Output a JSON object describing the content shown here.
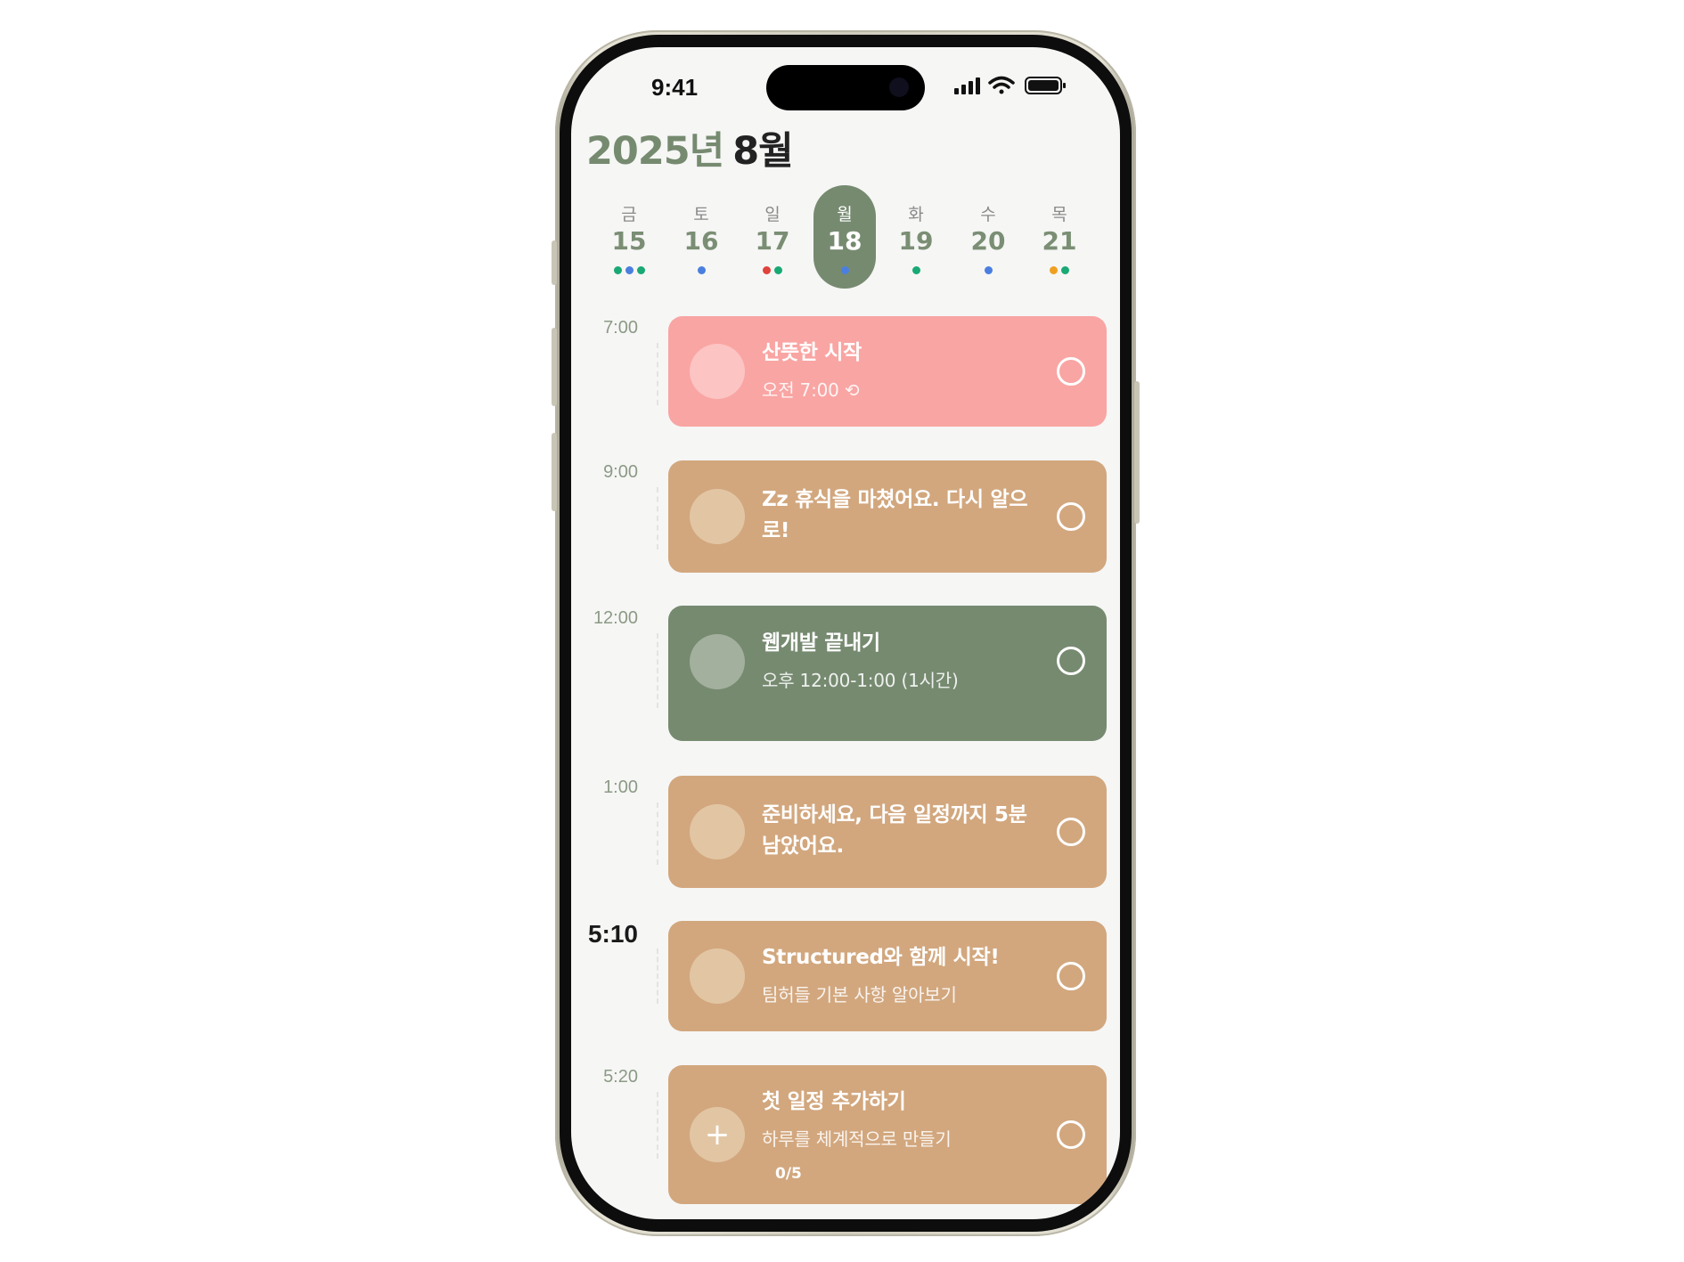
{
  "status_bar": {
    "time": "9:41"
  },
  "header": {
    "year": "2025년",
    "month": "8월"
  },
  "week": [
    {
      "weekday": "금",
      "date": "15",
      "dots": [
        "#19a974",
        "#4a7fe0",
        "#19a974"
      ],
      "selected": false
    },
    {
      "weekday": "토",
      "date": "16",
      "dots": [
        "#4a7fe0"
      ],
      "selected": false
    },
    {
      "weekday": "일",
      "date": "17",
      "dots": [
        "#e0433b",
        "#19a974"
      ],
      "selected": false
    },
    {
      "weekday": "월",
      "date": "18",
      "dots": [
        "#4a7fe0"
      ],
      "selected": true
    },
    {
      "weekday": "화",
      "date": "19",
      "dots": [
        "#19a974"
      ],
      "selected": false
    },
    {
      "weekday": "수",
      "date": "20",
      "dots": [
        "#4a7fe0"
      ],
      "selected": false
    },
    {
      "weekday": "목",
      "date": "21",
      "dots": [
        "#f0a020",
        "#19a974"
      ],
      "selected": false
    }
  ],
  "events": [
    {
      "time": "7:00",
      "title": "산뜻한 시작",
      "subtitle": "오전 7:00 ⟲",
      "color": "#f9a5a3",
      "avatar_color": "#fcc4c2"
    },
    {
      "time": "9:00",
      "title": "Zz 휴식을 마쳤어요. 다시 알으로!",
      "subtitle": "",
      "color": "#d2a77e",
      "avatar_color": "#e2c6a4"
    },
    {
      "time": "12:00",
      "title": "웹개발 끝내기",
      "subtitle": "오후 12:00-1:00 (1시간)",
      "color": "#768a70",
      "avatar_color": "#a3b09e"
    },
    {
      "time": "1:00",
      "title": "준비하세요, 다음 일정까지 5분 남았어요.",
      "subtitle": "",
      "color": "#d2a77e",
      "avatar_color": "#e2c6a4"
    },
    {
      "time": "5:10",
      "title": "Structured와 함께 시작!",
      "subtitle": "팀허들 기본 사항 알아보기",
      "color": "#d2a77e",
      "avatar_color": "#e2c6a4",
      "current": true
    },
    {
      "time": "5:20",
      "title": "첫 일정 추가하기",
      "subtitle": "하루를 체계적으로 만들기",
      "color": "#d2a77e",
      "avatar_color": "#e2c6a4",
      "icon": "plus-icon",
      "counter": "0/5"
    }
  ],
  "colors": {
    "accent": "#768a70",
    "background": "#f6f6f5"
  }
}
